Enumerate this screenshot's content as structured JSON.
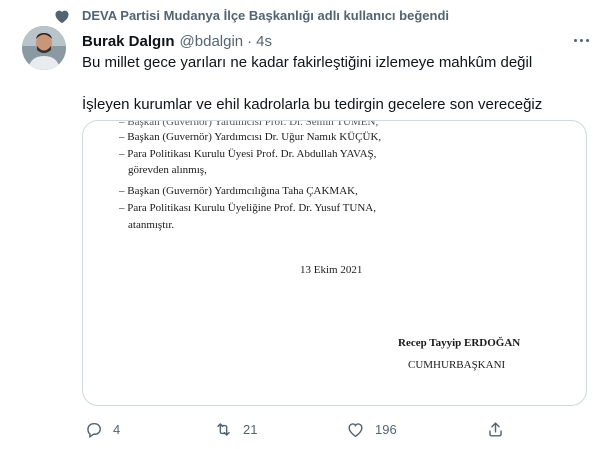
{
  "social_context": {
    "text": "DEVA Partisi Mudanya İlçe Başkanlığı adlı kullanıcı beğendi"
  },
  "author": {
    "name": "Burak Dalgın",
    "handle": "@bdalgin",
    "separator": "·",
    "time": "4s"
  },
  "tweet": {
    "line1": "Bu millet gece yarıları ne kadar fakirleştiğini izlemeye mahkûm değil",
    "line2": "İşleyen kurumlar ve ehil kadrolarla bu tedirgin gecelere son vereceğiz"
  },
  "document": {
    "cut_top": "– Başkan (Guvernör) Yardımcısı Prof. Dr. Semih TÜMEN,",
    "lines": [
      "–  Başkan (Guvernör) Yardımcısı Dr. Uğur Namık KÜÇÜK,",
      "–  Para Politikası Kurulu Üyesi Prof. Dr. Abdullah YAVAŞ,",
      "görevden alınmış,",
      "–  Başkan (Guvernör) Yardımcılığına Taha ÇAKMAK,",
      "–  Para Politikası Kurulu Üyeliğine Prof. Dr. Yusuf TUNA,",
      "atanmıştır."
    ],
    "date": "13 Ekim 2021",
    "signatory": "Recep Tayyip ERDOĞAN",
    "title": "CUMHURBAŞKANI"
  },
  "actions": {
    "reply_count": "4",
    "retweet_count": "21",
    "like_count": "196"
  },
  "icons": {
    "social_context": "heart-icon",
    "more": "more-icon",
    "reply": "reply-icon",
    "retweet": "retweet-icon",
    "like": "heart-icon",
    "share": "share-icon"
  },
  "colors": {
    "text": "#0f1419",
    "secondary": "#536471",
    "border": "#cfd9de"
  }
}
